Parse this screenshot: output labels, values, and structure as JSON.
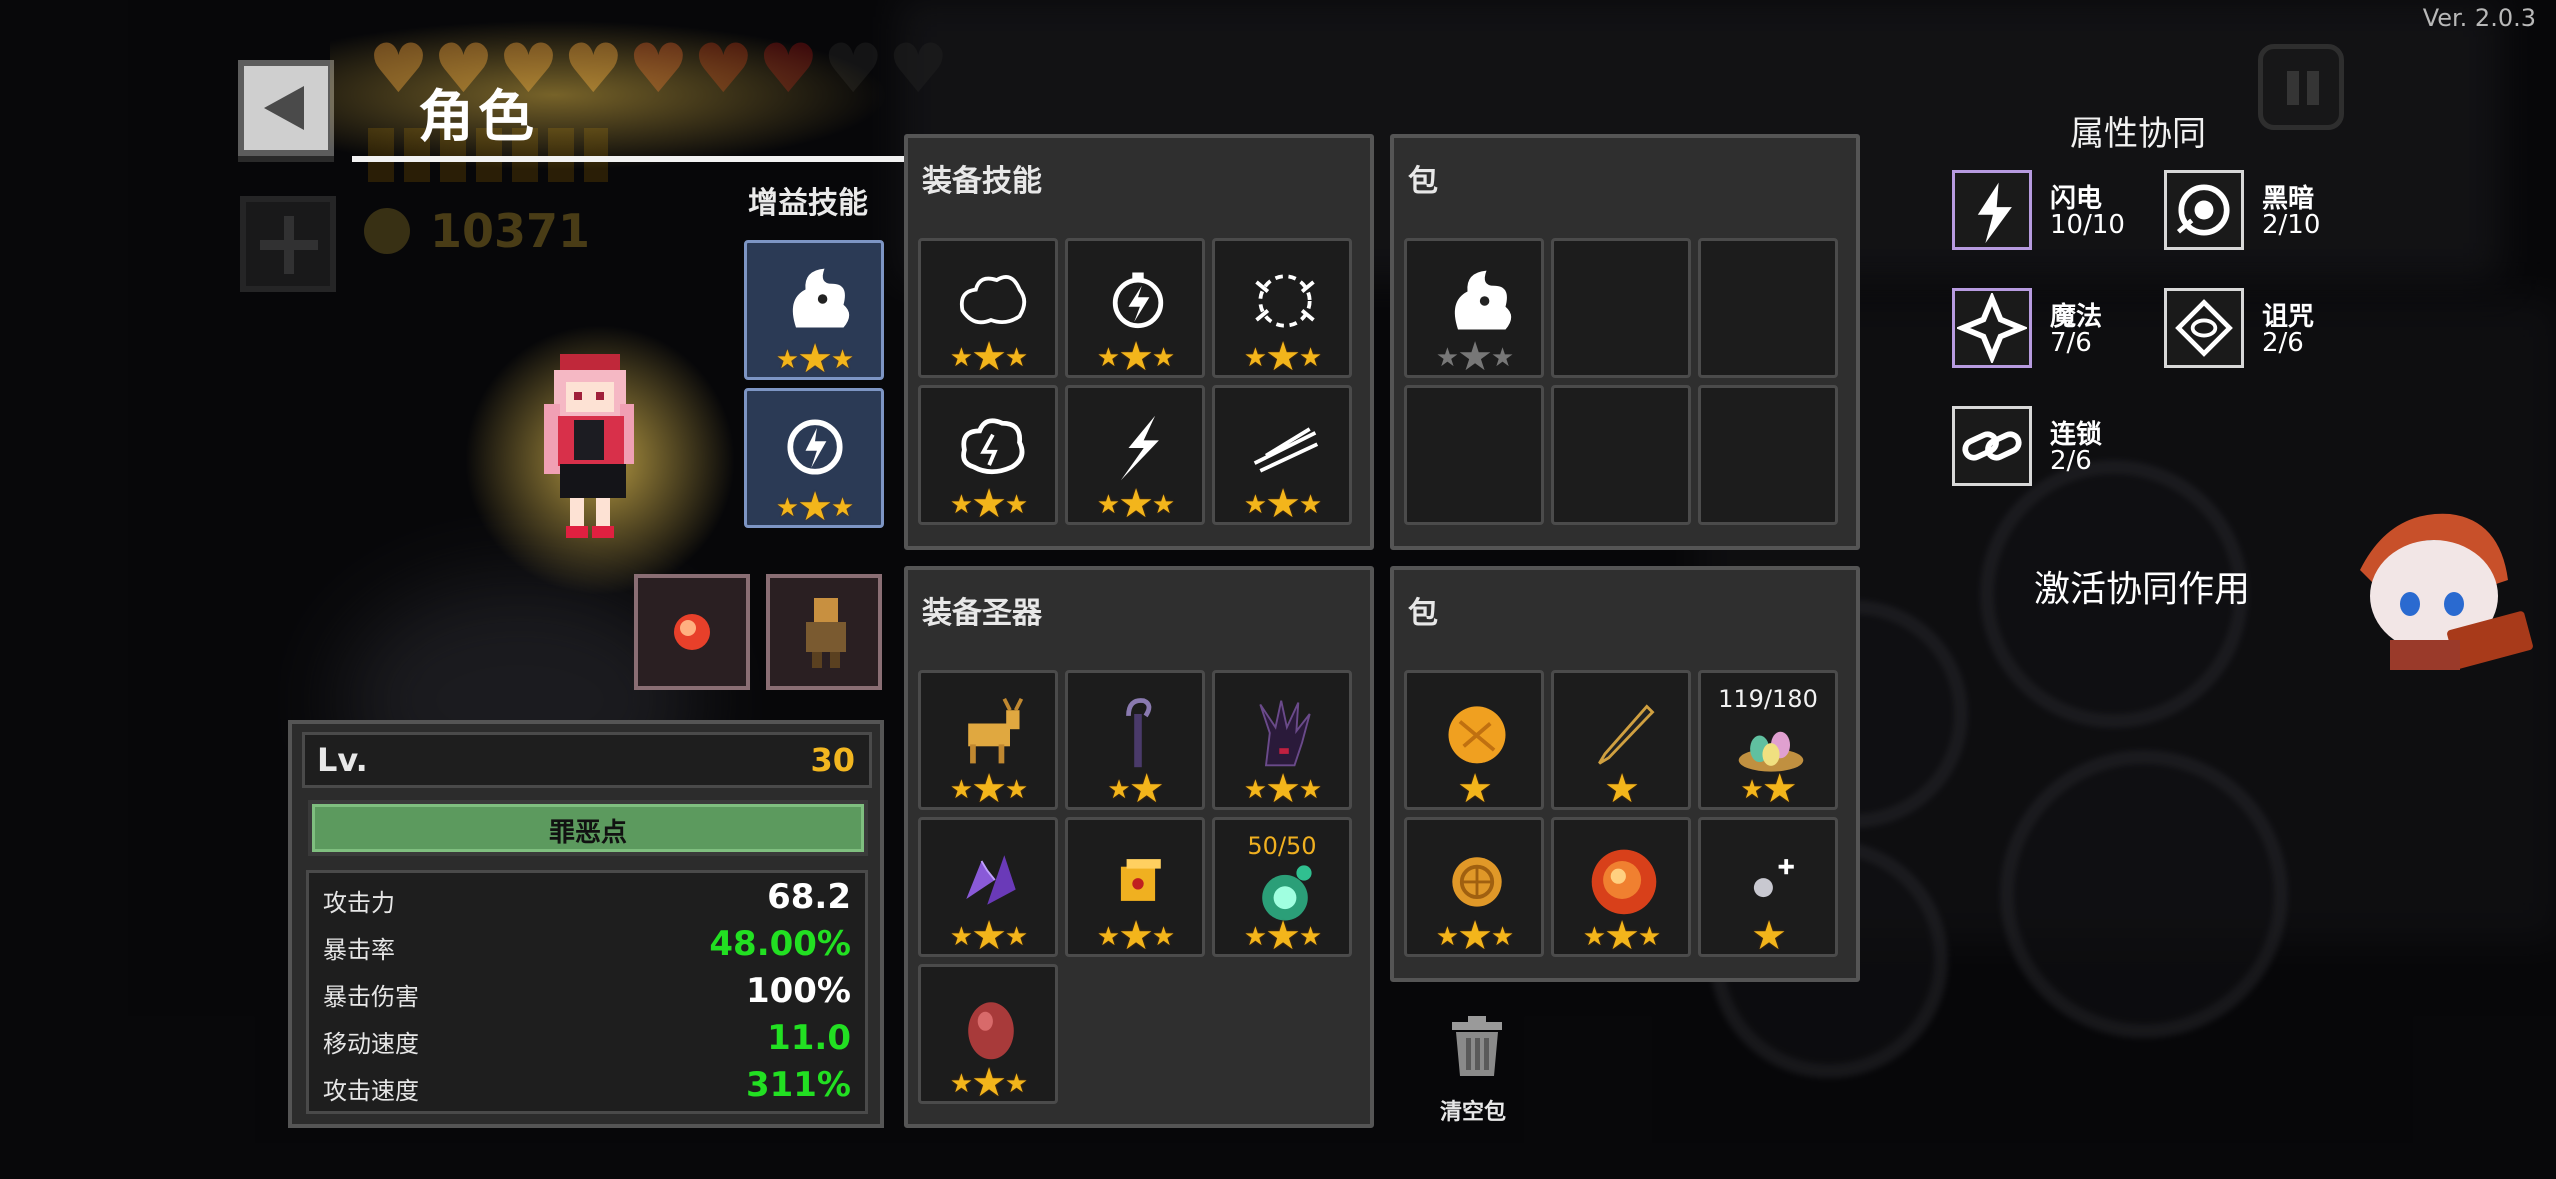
{
  "version": "Ver. 2.0.3",
  "header": {
    "title": "角色",
    "coins": "10371"
  },
  "colors": {
    "star": "#f3b51b",
    "green_stat": "#22e022",
    "level": "#f2b620",
    "xp_bar": "#5c9a5e",
    "boost_bg": "#2b3a55"
  },
  "boost": {
    "label": "增益技能",
    "slots": [
      {
        "icon": "ghost-flame-icon",
        "stars": 3
      },
      {
        "icon": "lightning-orb-icon",
        "stars": 3
      }
    ]
  },
  "equip_skills": {
    "title": "装备技能",
    "slots": [
      {
        "icon": "cloud-burst-icon",
        "stars": 3
      },
      {
        "icon": "lightning-lantern-icon",
        "stars": 3
      },
      {
        "icon": "spark-ring-icon",
        "stars": 3
      },
      {
        "icon": "thunder-cloud-icon",
        "stars": 3
      },
      {
        "icon": "lightning-bolt-icon",
        "stars": 3
      },
      {
        "icon": "slash-streak-icon",
        "stars": 3
      }
    ]
  },
  "bag1": {
    "title": "包",
    "slots": [
      {
        "icon": "ghost-flame-icon",
        "stars": 3,
        "grey": true
      }
    ]
  },
  "equip_relics": {
    "title": "装备圣器",
    "slots": [
      {
        "icon": "golden-goat-icon",
        "stars": 3
      },
      {
        "icon": "dark-staff-icon",
        "stars": 2
      },
      {
        "icon": "shadow-claw-icon",
        "stars": 3
      },
      {
        "icon": "purple-crystal-icon",
        "stars": 3
      },
      {
        "icon": "gold-die-icon",
        "stars": 3
      },
      {
        "icon": "green-spirit-icon",
        "stars": 3,
        "counter": "50/50"
      },
      {
        "icon": "red-egg-icon",
        "stars": 3
      }
    ]
  },
  "bag2": {
    "title": "包",
    "slots": [
      {
        "icon": "orange-orb-icon",
        "stars": 1
      },
      {
        "icon": "fountain-pen-icon",
        "stars": 1
      },
      {
        "icon": "egg-nest-icon",
        "stars": 2,
        "counter": "119/180"
      },
      {
        "icon": "gold-coin-icon",
        "stars": 3
      },
      {
        "icon": "fire-orb-icon",
        "stars": 3
      },
      {
        "icon": "sparkle-gem-icon",
        "stars": 1
      }
    ]
  },
  "relic_quick": [
    {
      "icon": "fire-gem-icon"
    },
    {
      "icon": "scarecrow-icon"
    }
  ],
  "stats": {
    "level_label": "Lv.",
    "level": "30",
    "xp_label": "罪恶点",
    "rows": [
      {
        "name": "攻击力",
        "value": "68.2",
        "green": false
      },
      {
        "name": "暴击率",
        "value": "48.00%",
        "green": true
      },
      {
        "name": "暴击伤害",
        "value": "100%",
        "green": false
      },
      {
        "name": "移动速度",
        "value": "11.0",
        "green": true
      },
      {
        "name": "攻击速度",
        "value": "311%",
        "green": true
      }
    ]
  },
  "trash": {
    "label": "清空包"
  },
  "synergy": {
    "title": "属性协同",
    "items": [
      {
        "name": "闪电",
        "count": "10/10",
        "icon": "lightning-icon",
        "active": true
      },
      {
        "name": "黑暗",
        "count": "2/10",
        "icon": "dark-eye-icon",
        "active": false
      },
      {
        "name": "魔法",
        "count": "7/6",
        "icon": "magic-star-icon",
        "active": true
      },
      {
        "name": "诅咒",
        "count": "2/6",
        "icon": "curse-eye-icon",
        "active": false
      },
      {
        "name": "连锁",
        "count": "2/6",
        "icon": "chain-link-icon",
        "active": false
      }
    ],
    "activate_label": "激活协同作用"
  }
}
